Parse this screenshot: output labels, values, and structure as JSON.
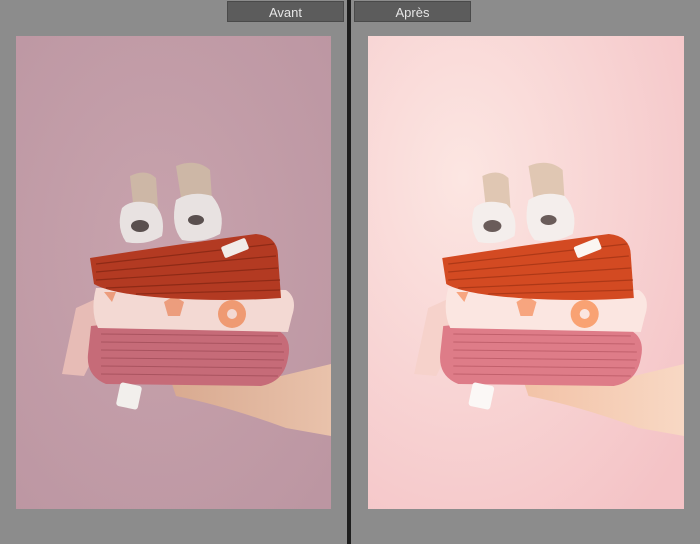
{
  "compare_view": {
    "before_label": "Avant",
    "after_label": "Après"
  },
  "photo": {
    "subject": "stack-of-folded-baby-clothes",
    "before_background": "#c7a3ad",
    "after_background": "#f6cfd0"
  },
  "colors": {
    "toolbar_bg": "#5c5c5c",
    "pane_bg": "#8c8c8c",
    "divider": "#1e1e1e",
    "label_text": "#e6e6e6"
  }
}
